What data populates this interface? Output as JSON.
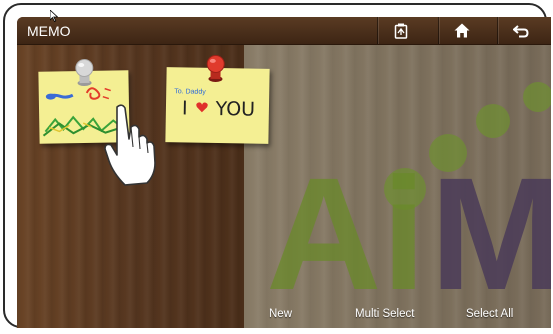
{
  "titlebar": {
    "title": "MEMO",
    "icons": [
      "memo-settings-icon",
      "home-icon",
      "back-icon"
    ]
  },
  "notes": [
    {
      "kind": "drawing",
      "pin_color": "#c9c9c9"
    },
    {
      "kind": "text",
      "pin_color": "#d8352a",
      "line1": "To. Daddy",
      "line2_before": "I",
      "line2_after": "YOU",
      "heart_color": "#e0302b"
    }
  ],
  "watermark": {
    "text_a": "Ai",
    "text_b": "M",
    "green": "#6a8a2a",
    "purple": "#4a3b58"
  },
  "bottombar": {
    "new_label": "New",
    "multi_select_label": "Multi Select",
    "select_all_label": "Select All"
  }
}
